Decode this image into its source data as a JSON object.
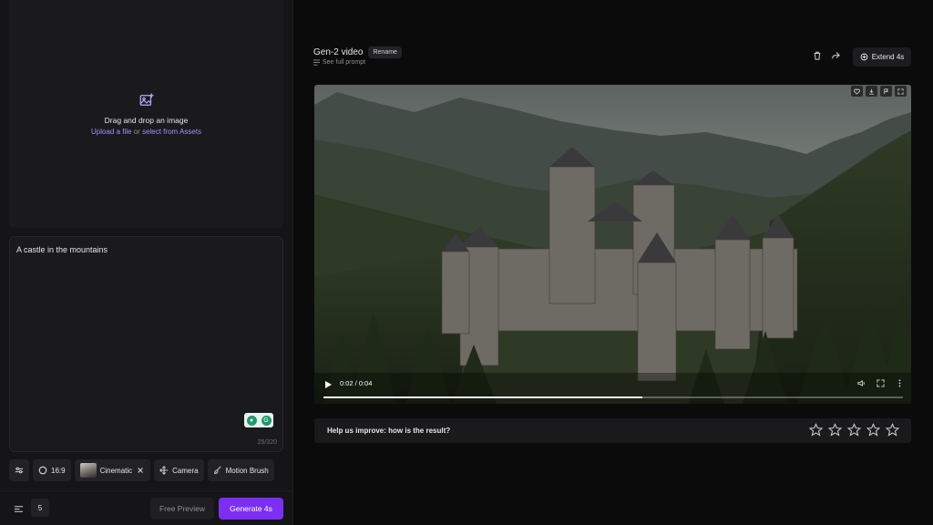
{
  "upload": {
    "title": "Drag and drop an image",
    "upload_link": "Upload a file",
    "or_text": " or ",
    "assets_link": "select from Assets",
    "icon": "image-plus-icon"
  },
  "prompt": {
    "text": "A castle in the mountains",
    "char_count": "25/320"
  },
  "toolbar": {
    "settings_icon": "sliders-icon",
    "ratio": "16:9",
    "style": "Cinematic",
    "camera": "Camera",
    "motion_brush": "Motion Brush"
  },
  "bottom": {
    "count": "5",
    "free_preview": "Free Preview",
    "generate": "Generate 4s"
  },
  "header": {
    "title": "Gen-2 video",
    "rename": "Rename",
    "see_prompt": "See full prompt",
    "extend": "Extend 4s"
  },
  "video": {
    "time": "0:02 / 0:04",
    "progress": 0.55
  },
  "feedback": {
    "question": "Help us improve: how is the result?",
    "stars": 5
  },
  "colors": {
    "accent": "#7b2ff2",
    "link": "#a98cff"
  }
}
